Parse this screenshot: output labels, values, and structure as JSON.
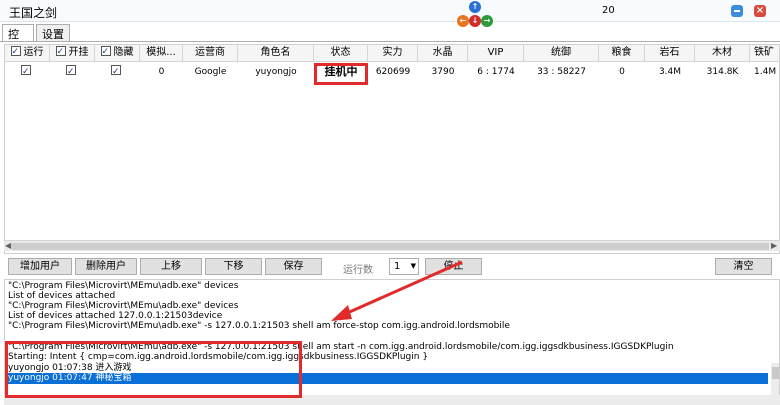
{
  "window": {
    "title": "王国之剑",
    "counter": "20",
    "colors": {
      "accent": "#0a6fd6",
      "annotation": "#e32a2a"
    }
  },
  "tabs": [
    {
      "label": "控制"
    },
    {
      "label": "设置"
    }
  ],
  "grid": {
    "columns": [
      "运行",
      "开挂",
      "隐藏",
      "模拟...",
      "运营商",
      "角色名",
      "状态",
      "实力",
      "水晶",
      "VIP",
      "统御",
      "粮食",
      "岩石",
      "木材",
      "铁矿"
    ],
    "row": {
      "run": true,
      "cheat": true,
      "hidden": true,
      "emulator": "0",
      "operator": "Google",
      "role": "yuyongjo",
      "status": "挂机中",
      "power": "620699",
      "crystal": "3790",
      "vip": "6 : 1774",
      "command": "33 : 58227",
      "food": "0",
      "stone": "3.4M",
      "wood": "314.8K",
      "iron": "1.4M"
    }
  },
  "toolbar": {
    "add_user": "增加用户",
    "delete_user": "删除用户",
    "move_up": "上移",
    "move_down": "下移",
    "save": "保存",
    "run_count_label": "运行数",
    "run_count_value": "1",
    "stop": "停止",
    "clear": "清空"
  },
  "log": [
    "\"C:\\Program Files\\Microvirt\\MEmu\\adb.exe\" devices",
    "List of devices attached",
    "\"C:\\Program Files\\Microvirt\\MEmu\\adb.exe\" devices",
    "List of devices attached 127.0.0.1:21503device",
    "\"C:\\Program Files\\Microvirt\\MEmu\\adb.exe\" -s 127.0.0.1:21503 shell am force-stop com.igg.android.lordsmobile",
    "\"C:\\Program Files\\Microvirt\\MEmu\\adb.exe\" -s 127.0.0.1:21503 shell am start -n com.igg.android.lordsmobile/com.igg.iggsdkbusiness.IGGSDKPlugin",
    "Starting: Intent { cmp=com.igg.android.lordsmobile/com.igg.iggsdkbusiness.IGGSDKPlugin }",
    "yuyongjo   01:07:38  进入游戏",
    "yuyongjo   01:07:47  神秘宝箱"
  ]
}
